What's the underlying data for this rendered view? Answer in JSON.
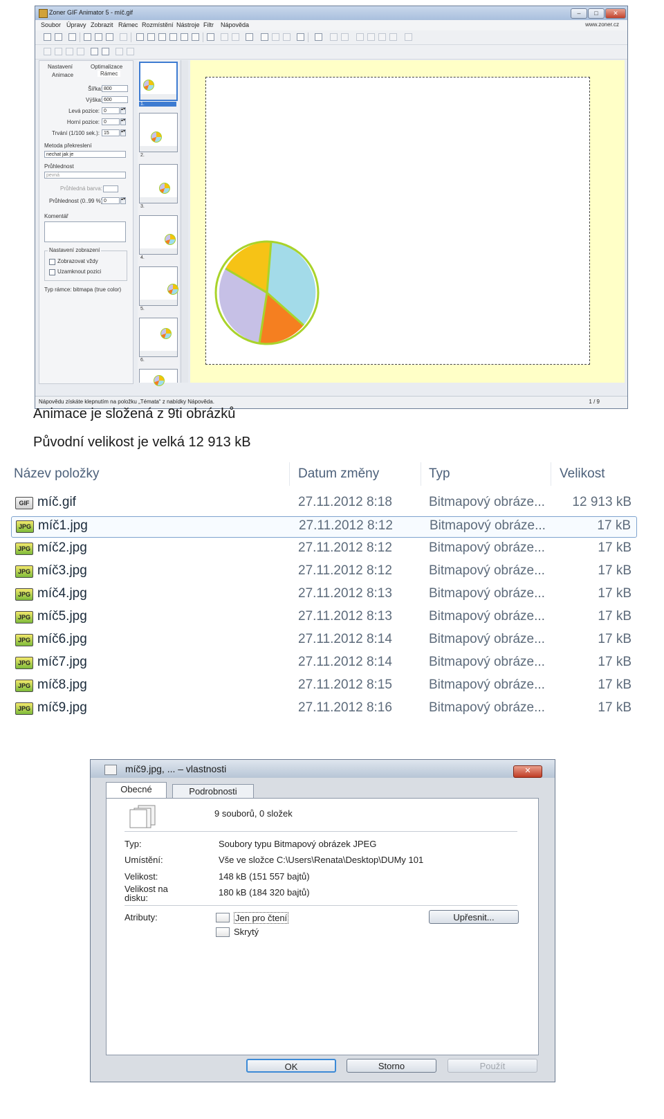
{
  "zoner": {
    "title": "Zoner GIF Animator 5 - míč.gif",
    "menus": [
      "Soubor",
      "Úpravy",
      "Zobrazit",
      "Rámec",
      "Rozmístění",
      "Nástroje",
      "Filtr",
      "Nápověda"
    ],
    "site": "www.zoner.cz",
    "tabs": [
      "Nastavení",
      "Optimalizace",
      "Animace",
      "Rámec"
    ],
    "fields": {
      "width_label": "Šířka:",
      "width_value": "800",
      "height_label": "Výška:",
      "height_value": "600",
      "left_label": "Levá pozice:",
      "left_value": "0",
      "top_label": "Horní pozice:",
      "top_value": "0",
      "duration_label": "Trvání (1/100 sek.):",
      "duration_value": "15",
      "redraw_label": "Metoda překreslení",
      "redraw_value": "nechat jak je",
      "transparency_label": "Průhlednost",
      "transparency_value": "pevná",
      "transparent_color_label": "Průhledná barva:",
      "opacity_label": "Průhlednost (0..99 %):",
      "opacity_value": "0",
      "comment_label": "Komentář",
      "display_group": "Nastavení zobrazení",
      "show_always": "Zobrazovat vždy",
      "lock_position": "Uzamknout pozici",
      "frame_type": "Typ rámce:  bitmapa (true color)"
    },
    "thumbs": [
      "1.",
      "2.",
      "3.",
      "4.",
      "5.",
      "6."
    ],
    "status_text": "Nápovědu získáte klepnutím na položku „Témata“ z nabídky Nápověda.",
    "status_page": "1 / 9",
    "pie_colors": {
      "yellow": "#f6c316",
      "blue": "#a3dbe9",
      "orange": "#f57f20",
      "lavender": "#c6c0e6",
      "rim": "#a9d32b"
    }
  },
  "captions": {
    "line1": "Animace je složená z 9ti obrázků",
    "line2": "Původní velikost je velká 12 913 kB"
  },
  "explorer": {
    "headers": {
      "name": "Název položky",
      "date": "Datum změny",
      "type": "Typ",
      "size": "Velikost"
    },
    "rows": [
      {
        "icon": "GIF",
        "name": "míč.gif",
        "date": "27.11.2012 8:18",
        "type": "Bitmapový obráze...",
        "size": "12 913 kB"
      },
      {
        "icon": "JPG",
        "name": "míč1.jpg",
        "date": "27.11.2012 8:12",
        "type": "Bitmapový obráze...",
        "size": "17 kB"
      },
      {
        "icon": "JPG",
        "name": "míč2.jpg",
        "date": "27.11.2012 8:12",
        "type": "Bitmapový obráze...",
        "size": "17 kB"
      },
      {
        "icon": "JPG",
        "name": "míč3.jpg",
        "date": "27.11.2012 8:12",
        "type": "Bitmapový obráze...",
        "size": "17 kB"
      },
      {
        "icon": "JPG",
        "name": "míč4.jpg",
        "date": "27.11.2012 8:13",
        "type": "Bitmapový obráze...",
        "size": "17 kB"
      },
      {
        "icon": "JPG",
        "name": "míč5.jpg",
        "date": "27.11.2012 8:13",
        "type": "Bitmapový obráze...",
        "size": "17 kB"
      },
      {
        "icon": "JPG",
        "name": "míč6.jpg",
        "date": "27.11.2012 8:14",
        "type": "Bitmapový obráze...",
        "size": "17 kB"
      },
      {
        "icon": "JPG",
        "name": "míč7.jpg",
        "date": "27.11.2012 8:14",
        "type": "Bitmapový obráze...",
        "size": "17 kB"
      },
      {
        "icon": "JPG",
        "name": "míč8.jpg",
        "date": "27.11.2012 8:15",
        "type": "Bitmapový obráze...",
        "size": "17 kB"
      },
      {
        "icon": "JPG",
        "name": "míč9.jpg",
        "date": "27.11.2012 8:16",
        "type": "Bitmapový obráze...",
        "size": "17 kB"
      }
    ]
  },
  "dialog": {
    "title": "míč9.jpg, ... – vlastnosti",
    "close": "✕",
    "tabs": [
      "Obecné",
      "Podrobnosti"
    ],
    "summary": "9 souborů, 0 složek",
    "type_label": "Typ:",
    "type_value": "Soubory typu Bitmapový obrázek JPEG",
    "location_label": "Umístění:",
    "location_value": "Vše ve složce C:\\Users\\Renata\\Desktop\\DUMy 101",
    "size_label": "Velikost:",
    "size_value": "148 kB (151 557 bajtů)",
    "disk_label": "Velikost na disku:",
    "disk_value": "180 kB (184 320 bajtů)",
    "attrs_label": "Atributy:",
    "readonly": "Jen pro čtení",
    "hidden": "Skrytý",
    "advanced": "Upřesnit...",
    "ok": "OK",
    "cancel": "Storno",
    "apply": "Použít"
  }
}
